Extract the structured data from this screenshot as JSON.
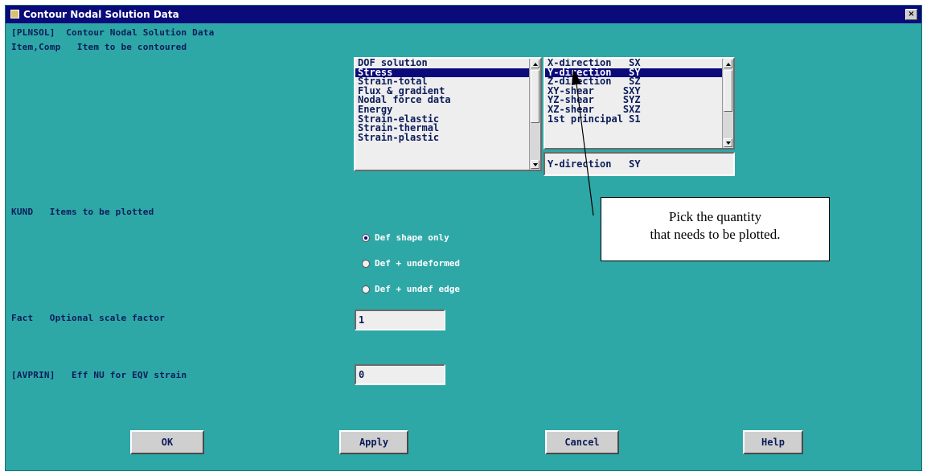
{
  "window": {
    "title": "Contour Nodal Solution Data",
    "close": "×"
  },
  "header_cmd": "[PLNSOL]  Contour Nodal Solution Data",
  "item_comp": {
    "label": "Item,Comp   Item to be contoured",
    "items": [
      "DOF solution",
      "Stress",
      "Strain-total",
      "Flux & gradient",
      "Nodal force data",
      "Energy",
      "Strain-elastic",
      "Strain-thermal",
      "Strain-plastic"
    ],
    "selected_item_index": 1,
    "components": [
      "X-direction   SX",
      "Y-direction   SY",
      "Z-direction   SZ",
      "XY-shear     SXY",
      "YZ-shear     SYZ",
      "XZ-shear     SXZ",
      "1st principal S1"
    ],
    "selected_component_index": 1,
    "selection_value": "Y-direction   SY"
  },
  "kund": {
    "label": "KUND   Items to be plotted",
    "options": [
      "Def shape only",
      "Def + undeformed",
      "Def + undef edge"
    ],
    "selected_index": 0
  },
  "fact": {
    "label": "Fact   Optional scale factor",
    "value": "1"
  },
  "avprin": {
    "label": "[AVPRIN]   Eff NU for EQV strain",
    "value": "0"
  },
  "buttons": {
    "ok": "OK",
    "apply": "Apply",
    "cancel": "Cancel",
    "help": "Help"
  },
  "annotation": {
    "line1": "Pick the quantity",
    "line2": "that needs to be plotted."
  },
  "colors": {
    "dialog_bg": "#2ea7a7",
    "title_bar": "#0a0a7a",
    "selection": "#0a0a7a",
    "label_text": "#0c1c5a"
  }
}
